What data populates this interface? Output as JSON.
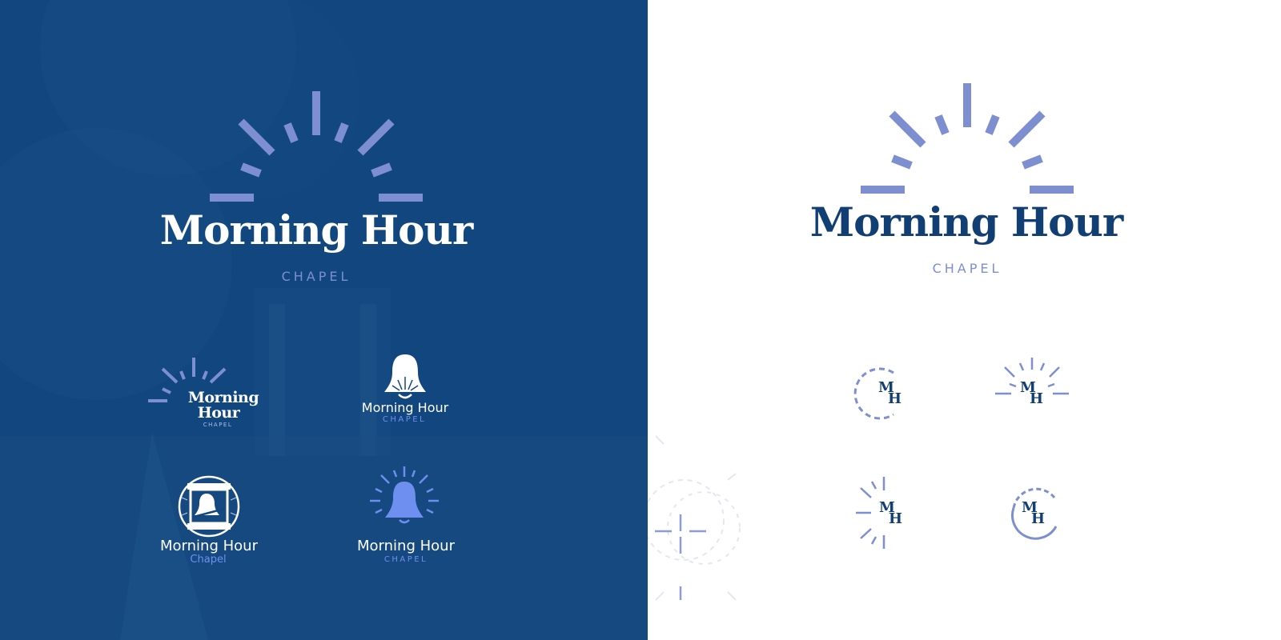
{
  "brand": {
    "name": "Morning Hour",
    "subtitle": "CHAPEL",
    "stack_line1": "Morning",
    "stack_line2": "Hour",
    "subtitle_title_case": "Chapel",
    "monogram_top": "M",
    "monogram_bottom": "H"
  },
  "colors": {
    "navy": "#11467e",
    "navy_text": "#123f73",
    "periwinkle": "#7d8fd0",
    "bright_periwinkle": "#6f8ff0",
    "white": "#ffffff"
  },
  "icons": [
    "sunrise-rays-icon",
    "bell-icon",
    "bell-window-badge-icon",
    "radiant-bell-icon",
    "mh-monogram-icon"
  ]
}
